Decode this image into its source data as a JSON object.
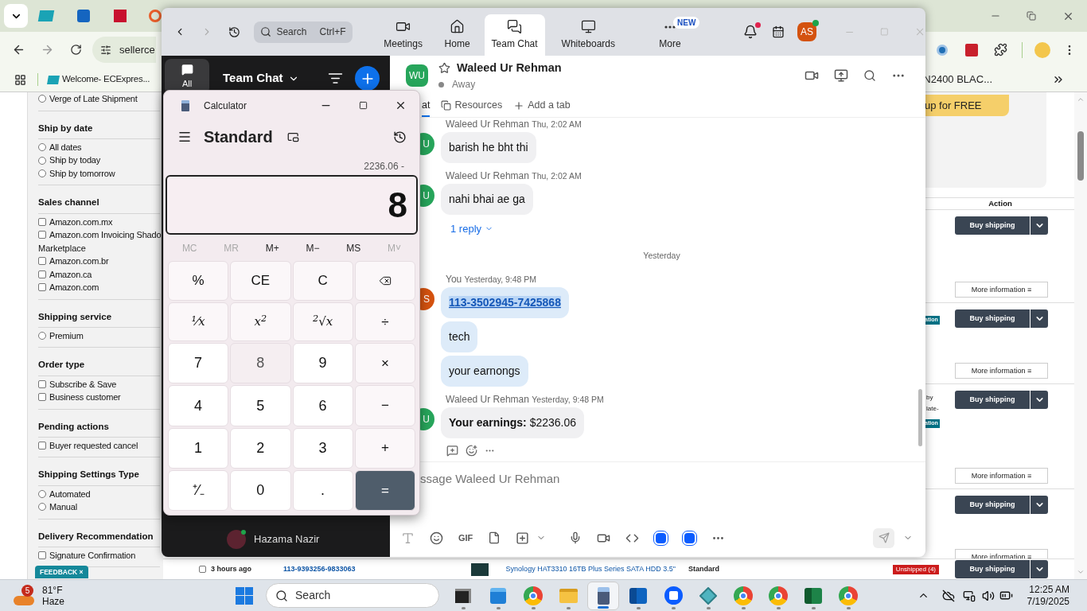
{
  "browser": {
    "address": "sellerce",
    "bookmarks": [
      {
        "label": "Welcome- ECExpres..."
      },
      {
        "label": "N2400 BLAC..."
      }
    ],
    "filters": [
      {
        "options": [
          {
            "label": "Verge of Late Shipment",
            "kind": "radio",
            "checked": false
          }
        ]
      },
      {
        "title": "Ship by date",
        "options": [
          {
            "label": "All dates",
            "kind": "radio",
            "checked": false
          },
          {
            "label": "Ship by today",
            "kind": "radio",
            "checked": false
          },
          {
            "label": "Ship by tomorrow",
            "kind": "radio",
            "checked": false
          }
        ]
      },
      {
        "title": "Sales channel",
        "options": [
          {
            "label": "Amazon.com.mx",
            "kind": "checkbox",
            "checked": false
          },
          {
            "label": "Amazon.com Invoicing Shado",
            "label_line_2": "Marketplace",
            "kind": "checkbox",
            "checked": false
          },
          {
            "label": "Amazon.com.br",
            "kind": "checkbox",
            "checked": false
          },
          {
            "label": "Amazon.ca",
            "kind": "checkbox",
            "checked": false
          },
          {
            "label": "Amazon.com",
            "kind": "checkbox",
            "checked": false
          }
        ]
      },
      {
        "title": "Shipping service",
        "options": [
          {
            "label": "Premium",
            "kind": "radio",
            "checked": false
          }
        ]
      },
      {
        "title": "Order type",
        "options": [
          {
            "label": "Subscribe & Save",
            "kind": "checkbox",
            "checked": false
          },
          {
            "label": "Business customer",
            "kind": "checkbox",
            "checked": false
          }
        ]
      },
      {
        "title": "Pending actions",
        "options": [
          {
            "label": "Buyer requested cancel",
            "kind": "checkbox",
            "checked": false
          }
        ]
      },
      {
        "title": "Shipping Settings Type",
        "options": [
          {
            "label": "Automated",
            "kind": "radio",
            "checked": false
          },
          {
            "label": "Manual",
            "kind": "radio",
            "checked": false
          }
        ]
      },
      {
        "title": "Delivery Recommendation",
        "options": [
          {
            "label": "Signature Confirmation",
            "kind": "checkbox",
            "checked": false
          }
        ]
      }
    ],
    "banner": "up for FREE",
    "action_header": "Action",
    "actions": [
      {
        "button": "Buy shipping",
        "more": "More information ≡"
      },
      {
        "button": "Buy shipping",
        "more": "More information ≡",
        "badge": "ation"
      },
      {
        "button": "Buy shipping",
        "more": "More information ≡",
        "notes": [
          "by",
          "late-"
        ],
        "badge": "ation"
      },
      {
        "button": "Buy shipping",
        "more": "More information ≡"
      }
    ],
    "bottom_row": {
      "checked": false,
      "age": "3 hours ago",
      "order": "113-9393256-9833063",
      "product": "Synology HAT3310 16TB Plus Series SATA HDD 3.5\"",
      "service": "Standard",
      "status": "Unshipped (4)",
      "button": "Buy shipping"
    },
    "feedback": "FEEDBACK ×"
  },
  "zoom": {
    "search": {
      "placeholder": "Search",
      "shortcut": "Ctrl+F"
    },
    "nav": [
      {
        "label": "Meetings",
        "kind": "video",
        "selected": false
      },
      {
        "label": "Home",
        "kind": "home",
        "selected": false
      },
      {
        "label": "Team Chat",
        "kind": "chat",
        "selected": true
      },
      {
        "label": "Whiteboards",
        "kind": "board",
        "selected": false
      },
      {
        "label": "More",
        "kind": "more",
        "selected": false,
        "badge": "NEW"
      }
    ],
    "user_initials": "AS",
    "sidebar": {
      "tab": "All",
      "title": "Team Chat",
      "contacts": [
        {
          "name": "Hazama Nazir"
        }
      ]
    },
    "chat": {
      "initials": "WU",
      "name": "Waleed Ur Rehman",
      "status": "Away",
      "tabs": [
        {
          "label": "at",
          "selected": true
        },
        {
          "label": "Resources",
          "selected": false
        },
        {
          "label": "Add a tab",
          "selected": false
        }
      ],
      "timeline": [
        {
          "kind": "group",
          "sender": "Waleed Ur Rehman",
          "time": "Thu, 2:02 AM",
          "avatar": "U",
          "mine": false,
          "bubbles": [
            {
              "text": "barish he bht thi",
              "link": false
            }
          ]
        },
        {
          "kind": "group",
          "sender": "Waleed Ur Rehman",
          "time": "Thu, 2:02 AM",
          "avatar": "U",
          "mine": false,
          "bubbles": [
            {
              "text": "nahi bhai ae ga",
              "link": false
            }
          ],
          "reply": "1 reply"
        },
        {
          "kind": "divider",
          "text": "Yesterday"
        },
        {
          "kind": "group",
          "sender": "You",
          "time": "Yesterday, 9:48 PM",
          "avatar": "S",
          "mine": true,
          "bubbles": [
            {
              "text": "113-3502945-7425868",
              "link": true
            },
            {
              "text": "tech",
              "link": false
            },
            {
              "text": "your earnongs",
              "link": false
            }
          ]
        },
        {
          "kind": "group",
          "sender": "Waleed Ur Rehman",
          "time": "Yesterday, 9:48 PM",
          "avatar": "U",
          "mine": false,
          "bubbles": [
            {
              "text": "**Your earnings:** $2236.06",
              "link": false
            }
          ],
          "reactions": true
        }
      ],
      "composer": {
        "placeholder": "ssage Waleed Ur Rehman",
        "gif": "GIF"
      }
    }
  },
  "calculator": {
    "title": "Calculator",
    "mode": "Standard",
    "expression": "2236.06 -",
    "display": "8",
    "memory": [
      {
        "label": "MC",
        "disabled": true
      },
      {
        "label": "MR",
        "disabled": true
      },
      {
        "label": "M+",
        "disabled": false
      },
      {
        "label": "M−",
        "disabled": false
      },
      {
        "label": "MS",
        "disabled": false
      },
      {
        "label": "M˅",
        "disabled": true
      }
    ],
    "keys": [
      {
        "label": "%",
        "kind": "fn",
        "highlighted": false
      },
      {
        "label": "CE",
        "kind": "fn",
        "highlighted": false
      },
      {
        "label": "C",
        "kind": "fn",
        "highlighted": false
      },
      {
        "kind": "backspace",
        "highlighted": false
      },
      {
        "label": "¹⁄x",
        "kind": "fn",
        "highlighted": false
      },
      {
        "label": "x$^{2}$",
        "kind": "fn",
        "highlighted": false
      },
      {
        "label": "$^{2}$√x",
        "kind": "fn",
        "highlighted": false
      },
      {
        "label": "÷",
        "kind": "fn",
        "highlighted": false
      },
      {
        "label": "7",
        "kind": "num",
        "highlighted": false
      },
      {
        "label": "8",
        "kind": "num",
        "highlighted": true
      },
      {
        "label": "9",
        "kind": "num",
        "highlighted": false
      },
      {
        "label": "×",
        "kind": "fn",
        "highlighted": false
      },
      {
        "label": "4",
        "kind": "num",
        "highlighted": false
      },
      {
        "label": "5",
        "kind": "num",
        "highlighted": false
      },
      {
        "label": "6",
        "kind": "num",
        "highlighted": false
      },
      {
        "label": "−",
        "kind": "fn",
        "highlighted": false
      },
      {
        "label": "1",
        "kind": "num",
        "highlighted": false
      },
      {
        "label": "2",
        "kind": "num",
        "highlighted": false
      },
      {
        "label": "3",
        "kind": "num",
        "highlighted": false
      },
      {
        "label": "+",
        "kind": "fn",
        "highlighted": false
      },
      {
        "label": "⁺⁄₋",
        "kind": "num",
        "highlighted": false
      },
      {
        "label": "0",
        "kind": "num",
        "highlighted": false
      },
      {
        "label": ".",
        "kind": "num",
        "highlighted": false
      },
      {
        "label": "=",
        "kind": "eq",
        "highlighted": false
      }
    ]
  },
  "taskbar": {
    "weather": {
      "badge": "5",
      "temp": "81°F",
      "condition": "Haze"
    },
    "search": "Search",
    "apps": [
      {
        "kind": "task-view",
        "active": false
      },
      {
        "kind": "store",
        "active": false
      },
      {
        "kind": "chrome",
        "active": false
      },
      {
        "kind": "folder",
        "active": false
      },
      {
        "kind": "calculator",
        "active": true
      },
      {
        "kind": "outlook",
        "active": false
      },
      {
        "kind": "zoom",
        "active": false
      },
      {
        "kind": "diamond",
        "active": false
      },
      {
        "kind": "chrome",
        "active": false
      },
      {
        "kind": "chrome",
        "active": false
      },
      {
        "kind": "excel",
        "active": false
      },
      {
        "kind": "chrome",
        "active": false
      }
    ],
    "time": "12:25 AM",
    "date": "7/19/2025"
  }
}
